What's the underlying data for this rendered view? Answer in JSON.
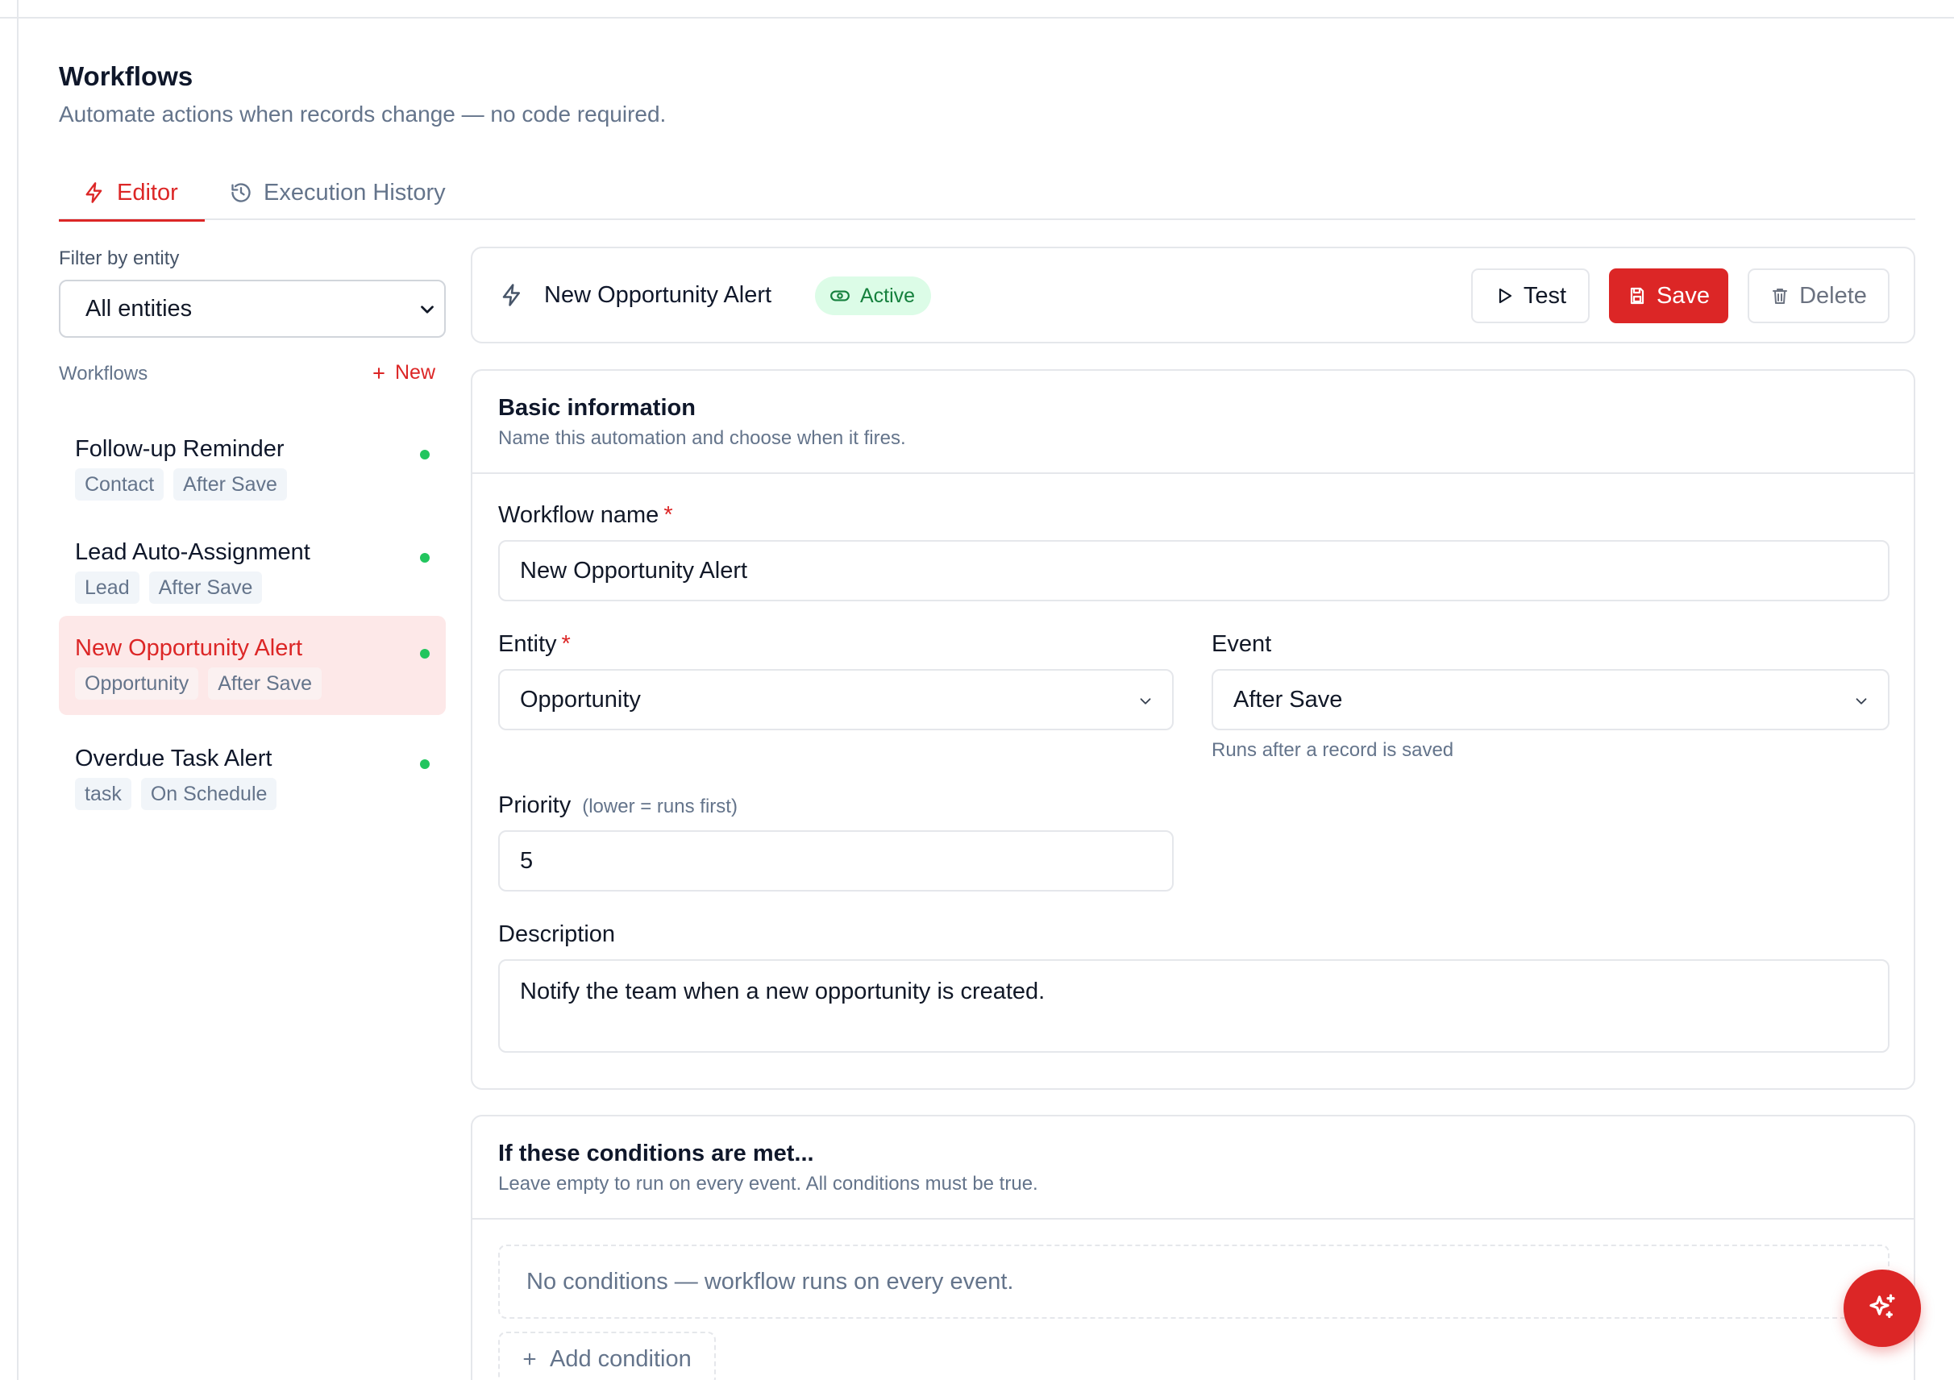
{
  "page": {
    "title": "Workflows",
    "subtitle": "Automate actions when records change — no code required."
  },
  "tabs": [
    {
      "label": "Editor",
      "icon": "bolt-icon",
      "active": true
    },
    {
      "label": "Execution History",
      "icon": "history-icon",
      "active": false
    }
  ],
  "sidebar": {
    "filter_label": "Filter by entity",
    "filter_value": "All entities",
    "workflows_label": "Workflows",
    "new_label": "New",
    "items": [
      {
        "name": "Follow-up Reminder",
        "tags": [
          "Contact",
          "After Save"
        ],
        "status": "active",
        "selected": false
      },
      {
        "name": "Lead Auto-Assignment",
        "tags": [
          "Lead",
          "After Save"
        ],
        "status": "active",
        "selected": false
      },
      {
        "name": "New Opportunity Alert",
        "tags": [
          "Opportunity",
          "After Save"
        ],
        "status": "active",
        "selected": true
      },
      {
        "name": "Overdue Task Alert",
        "tags": [
          "task",
          "On Schedule"
        ],
        "status": "active",
        "selected": false
      }
    ]
  },
  "header_card": {
    "title": "New Opportunity Alert",
    "status_badge": "Active",
    "test_label": "Test",
    "save_label": "Save",
    "delete_label": "Delete"
  },
  "basic_info": {
    "title": "Basic information",
    "description": "Name this automation and choose when it fires.",
    "name_label": "Workflow name",
    "name_value": "New Opportunity Alert",
    "entity_label": "Entity",
    "entity_value": "Opportunity",
    "event_label": "Event",
    "event_value": "After Save",
    "event_help": "Runs after a record is saved",
    "priority_label": "Priority",
    "priority_hint": "(lower = runs first)",
    "priority_value": "5",
    "description_label": "Description",
    "description_value": "Notify the team when a new opportunity is created."
  },
  "conditions": {
    "title": "If these conditions are met...",
    "description": "Leave empty to run on every event. All conditions must be true.",
    "empty_text": "No conditions — workflow runs on every event.",
    "add_label": "Add condition"
  },
  "colors": {
    "accent": "#dc2626",
    "active_green": "#22c55e",
    "badge_bg": "#dcfce7",
    "muted_text": "#64748b"
  }
}
